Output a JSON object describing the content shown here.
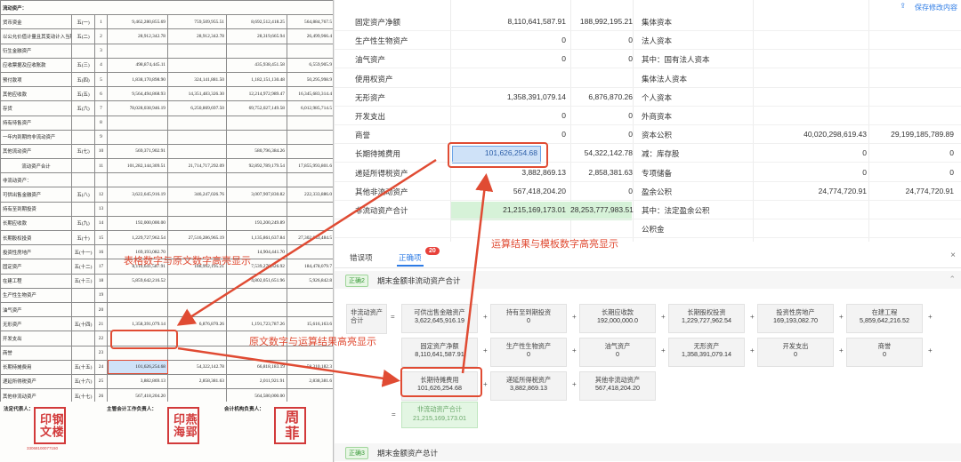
{
  "doc": {
    "header_label": "流动资产：",
    "rows": [
      [
        "货币资金",
        "五(一)",
        "1",
        "9,462,280,855.69",
        "759,509,955.51",
        "8,692,512,418.25",
        "564,884,767.5"
      ],
      [
        "以公允价值计量且其变动计入当期损益的金融资产",
        "五(二)",
        "2",
        "28,912,342.78",
        "28,912,342.78",
        "28,319,665.94",
        "26,499,966.4"
      ],
      [
        "衍生金融资产",
        "",
        "3",
        "",
        "",
        "",
        ""
      ],
      [
        "应收票据及应收账款",
        "五(三)",
        "4",
        "498,874,445.11",
        "",
        "435,938,451.58",
        "6,559,905.9"
      ],
      [
        "预付款项",
        "五(四)",
        "5",
        "1,838,170,898.90",
        "324,141,881.50",
        "1,182,151,130.48",
        "50,295,998.9"
      ],
      [
        "其他应收款",
        "五(五)",
        "6",
        "9,564,494,868.93",
        "14,351,483,326.30",
        "12,214,972,989.47",
        "16,345,683,314.4"
      ],
      [
        "存货",
        "五(六)",
        "7",
        "78,028,038,946.19",
        "6,250,869,697.50",
        "69,752,027,149.58",
        "6,012,985,714.5"
      ],
      [
        "持有待售资产",
        "",
        "8",
        "",
        "",
        "",
        ""
      ],
      [
        "一年内到期的非流动资产",
        "",
        "9",
        "",
        "",
        "",
        ""
      ],
      [
        "其他流动资产",
        "五(七)",
        "10",
        "569,371,902.91",
        "",
        "580,796,384.26",
        ""
      ],
      [
        "流动资产合计",
        "",
        "11",
        "101,282,144,309.51",
        "21,714,717,292.09",
        "92,892,789,179.54",
        "17,855,993,801.6"
      ],
      [
        "非流动资产：",
        "",
        "",
        "",
        "",
        "",
        ""
      ],
      [
        "可供出售金融资产",
        "五(八)",
        "12",
        "3,622,645,916.19",
        "346,247,026.76",
        "3,007,907,830.82",
        "222,333,886.0"
      ],
      [
        "持有至到期投资",
        "",
        "13",
        "",
        "",
        "",
        ""
      ],
      [
        "长期应收款",
        "五(九)",
        "14",
        "192,000,000.00",
        "",
        "193,200,249.89",
        ""
      ],
      [
        "长期股权投资",
        "五(十)",
        "15",
        "1,229,727,962.54",
        "27,516,286,965.19",
        "1,135,861,637.84",
        "27,302,843,484.5"
      ],
      [
        "投资性房地产",
        "五(十一)",
        "16",
        "169,193,082.70",
        "",
        "14,904,441.70",
        ""
      ],
      [
        "固定资产",
        "五(十二)",
        "17",
        "8,110,641,587.91",
        "188,992,195.21",
        "7,539,270,326.92",
        "184,478,079.7"
      ],
      [
        "在建工程",
        "五(十三)",
        "18",
        "5,859,642,216.52",
        "",
        "4,802,051,651.96",
        "5,926,842.8"
      ],
      [
        "生产性生物资产",
        "",
        "19",
        "",
        "",
        "",
        ""
      ],
      [
        "油气资产",
        "",
        "20",
        "",
        "",
        "",
        ""
      ],
      [
        "无形资产",
        "五(十四)",
        "21",
        "1,358,391,079.14",
        "6,876,870.26",
        "1,191,723,787.26",
        "15,616,163.6"
      ],
      [
        "开发支出",
        "",
        "22",
        "",
        "",
        "",
        ""
      ],
      [
        "商誉",
        "",
        "23",
        "",
        "",
        "",
        ""
      ],
      [
        "长期待摊费用",
        "五(十五)",
        "24",
        "101,626,254.68",
        "54,322,142.78",
        "66,818,183.19",
        "58,310,182.3"
      ],
      [
        "递延所得税资产",
        "五(十六)",
        "25",
        "3,882,869.13",
        "2,858,381.63",
        "2,011,921.91",
        "2,838,381.6"
      ],
      [
        "其他非流动资产",
        "五(十七)",
        "26",
        "567,418,204.20",
        "",
        "564,580,000.00",
        ""
      ],
      [
        "非流动资产合计",
        "",
        "27",
        "21,215,169,173.01",
        "28,253,777,983.51",
        "18,785,887,750.51",
        "27,602,006,166.7"
      ],
      [
        "资产总计",
        "",
        "28",
        "122,417,313,481.52",
        "49,968,495,275.58",
        "111,678,676,929.95",
        "45,443,482,967.1"
      ]
    ],
    "sig1_label": "法定代表人：",
    "sig2_label": "主管会计工作负责人：",
    "sig3_label": "会计机构负责人：",
    "stamp1": "钢楼印文",
    "stamp1_sub": "33068100077150",
    "stamp2": "燕郢印海",
    "stamp3": "周菲"
  },
  "grid": {
    "save_label": "保存修改内容",
    "rows": [
      {
        "l": "固定资产净额",
        "v1": "8,110,641,587.91",
        "v2": "188,992,195.21",
        "rl": "集体资本",
        "r1": "",
        "r2": ""
      },
      {
        "l": "生产性生物资产",
        "v1": "0",
        "v2": "0",
        "rl": "法人资本",
        "r1": "",
        "r2": ""
      },
      {
        "l": "油气资产",
        "v1": "0",
        "v2": "0",
        "rl": "其中：国有法人资本",
        "r1": "",
        "r2": ""
      },
      {
        "l": "使用权资产",
        "v1": "",
        "v2": "",
        "rl": "集体法人资本",
        "r1": "",
        "r2": ""
      },
      {
        "l": "无形资产",
        "v1": "1,358,391,079.14",
        "v2": "6,876,870.26",
        "rl": "个人资本",
        "r1": "",
        "r2": ""
      },
      {
        "l": "开发支出",
        "v1": "0",
        "v2": "0",
        "rl": "外商资本",
        "r1": "",
        "r2": ""
      },
      {
        "l": "商誉",
        "v1": "0",
        "v2": "0",
        "rl": "资本公积",
        "r1": "40,020,298,619.43",
        "r2": "29,199,185,789.89"
      },
      {
        "l": "长期待摊费用",
        "v1": "101,626,254.68",
        "v2": "54,322,142.78",
        "rl": "减：库存股",
        "r1": "0",
        "r2": "0"
      },
      {
        "l": "递延所得税资产",
        "v1": "3,882,869.13",
        "v2": "2,858,381.63",
        "rl": "专项储备",
        "r1": "0",
        "r2": "0"
      },
      {
        "l": "其他非流动资产",
        "v1": "567,418,204.20",
        "v2": "0",
        "rl": "盈余公积",
        "r1": "24,774,720.91",
        "r2": "24,774,720.91"
      },
      {
        "l": "非流动资产合计",
        "v1": "21,215,169,173.01",
        "v2": "28,253,777,983.51",
        "rl": "其中：法定盈余公积",
        "r1": "",
        "r2": ""
      },
      {
        "l": "",
        "v1": "",
        "v2": "",
        "rl": "公积金",
        "r1": "",
        "r2": ""
      }
    ]
  },
  "tabs": {
    "error_label": "错误项",
    "correct_label": "正确项",
    "correct_count": "20"
  },
  "rule2": {
    "tag": "正确2",
    "title": "期末金额非流动资产合计",
    "lhs_label": "非流动资产合计",
    "items": [
      {
        "name": "可供出售金融资产",
        "value": "3,622,645,916.19"
      },
      {
        "name": "持有至到期投资",
        "value": "0"
      },
      {
        "name": "长期应收款",
        "value": "192,000,000.0"
      },
      {
        "name": "长期股权投资",
        "value": "1,229,727,962.54"
      },
      {
        "name": "投资性房地产",
        "value": "169,193,082.70"
      },
      {
        "name": "在建工程",
        "value": "5,859,642,216.52"
      },
      {
        "name": "固定资产净额",
        "value": "8,110,641,587.91"
      },
      {
        "name": "生产性生物资产",
        "value": "0"
      },
      {
        "name": "油气资产",
        "value": "0"
      },
      {
        "name": "无形资产",
        "value": "1,358,391,079.14"
      },
      {
        "name": "开发支出",
        "value": "0"
      },
      {
        "name": "商誉",
        "value": "0"
      },
      {
        "name": "长期待摊费用",
        "value": "101,626,254.68"
      },
      {
        "name": "递延所得税资产",
        "value": "3,882,869.13"
      },
      {
        "name": "其他非流动资产",
        "value": "567,418,204.20"
      }
    ],
    "result_name": "非流动资产合计",
    "result_value": "21,215,169,173.01"
  },
  "rule3": {
    "tag": "正确3",
    "title": "期末金额资产总计"
  },
  "annotations": {
    "a1": "表格数字与原文数字高亮显示",
    "a2": "运算结果与模板数字高亮显示",
    "a3": "原文数字与运算结果高亮显示"
  },
  "colors": {
    "accent": "#2d7be5",
    "highlight_red": "#e04b33",
    "highlight_blue": "#cfe2f8",
    "ok_green": "#d6f2d8"
  }
}
